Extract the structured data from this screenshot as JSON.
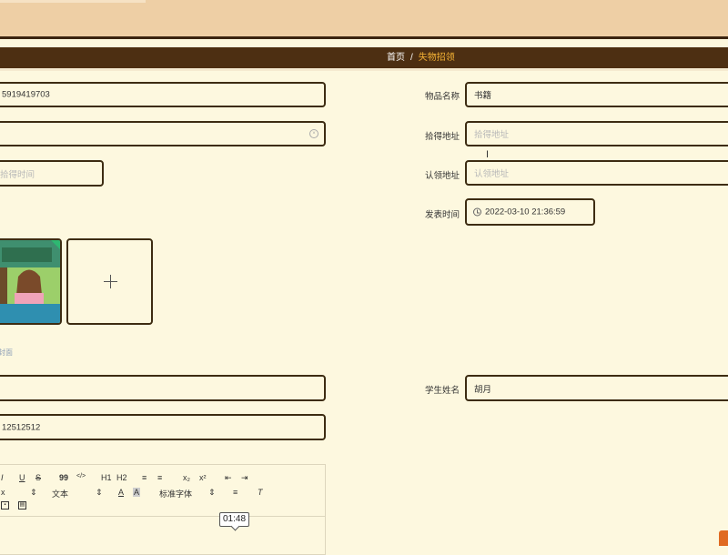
{
  "header": {
    "breadcrumb": {
      "home": "首页",
      "separator": "/",
      "current": "失物招领"
    }
  },
  "form": {
    "left_top_field": {
      "value": "5919419703"
    },
    "left_second_field": {
      "value": ""
    },
    "pickup_time_field": {
      "placeholder": "拾得时间"
    },
    "item_name": {
      "label": "物品名称",
      "value": "书籍"
    },
    "pickup_location": {
      "label": "拾得地址",
      "placeholder": "拾得地址"
    },
    "claim_location": {
      "label": "认领地址",
      "placeholder": "认领地址"
    },
    "publish_time": {
      "label": "发表时间",
      "value": "2022-03-10 21:36:59"
    },
    "cover_hint": "封面",
    "left_lower_field": {
      "value": ""
    },
    "phone_field": {
      "value": "12512512"
    },
    "student_name": {
      "label": "学生姓名",
      "value": "胡月"
    }
  },
  "editor": {
    "toolbar_row1": [
      "I",
      "U",
      "S",
      "99",
      "</>",
      "H1",
      "H2",
      "≡",
      "≡",
      "x₂",
      "x²",
      "⇤",
      "⇥"
    ],
    "font_size_select": "x",
    "text_type_select": "文本",
    "font_family_select": "标准字体"
  },
  "video_tooltip": "01:48",
  "colors": {
    "page_background": "#fdf8df",
    "top_bar": "#eecfa5",
    "nav_bar": "#4d2f12",
    "breadcrumb_active": "#f5b335",
    "input_border": "#3d2c12"
  }
}
